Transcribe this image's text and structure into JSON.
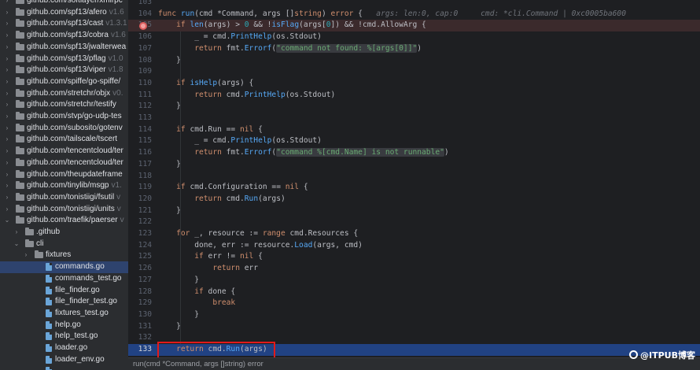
{
  "sidebar": {
    "rows": [
      {
        "type": "folder",
        "level": 1,
        "name": "github.com/softlayer/xmlrpc",
        "version": ""
      },
      {
        "type": "folder",
        "level": 1,
        "name": "github.com/spf13/afero",
        "version": "v1.6"
      },
      {
        "type": "folder",
        "level": 1,
        "name": "github.com/spf13/cast",
        "version": "v1.3.1"
      },
      {
        "type": "folder",
        "level": 1,
        "name": "github.com/spf13/cobra",
        "version": "v1.6"
      },
      {
        "type": "folder",
        "level": 1,
        "name": "github.com/spf13/jwalterwea",
        "version": ""
      },
      {
        "type": "folder",
        "level": 1,
        "name": "github.com/spf13/pflag",
        "version": "v1.0"
      },
      {
        "type": "folder",
        "level": 1,
        "name": "github.com/spf13/viper",
        "version": "v1.8"
      },
      {
        "type": "folder",
        "level": 1,
        "name": "github.com/spiffe/go-spiffe/",
        "version": ""
      },
      {
        "type": "folder",
        "level": 1,
        "name": "github.com/stretchr/objx",
        "version": "v0."
      },
      {
        "type": "folder",
        "level": 1,
        "name": "github.com/stretchr/testify",
        "version": ""
      },
      {
        "type": "folder",
        "level": 1,
        "name": "github.com/stvp/go-udp-tes",
        "version": ""
      },
      {
        "type": "folder",
        "level": 1,
        "name": "github.com/subosito/gotenv",
        "version": ""
      },
      {
        "type": "folder",
        "level": 1,
        "name": "github.com/tailscale/tscert",
        "version": ""
      },
      {
        "type": "folder",
        "level": 1,
        "name": "github.com/tencentcloud/ter",
        "version": ""
      },
      {
        "type": "folder",
        "level": 1,
        "name": "github.com/tencentcloud/ter",
        "version": ""
      },
      {
        "type": "folder",
        "level": 1,
        "name": "github.com/theupdateframe",
        "version": ""
      },
      {
        "type": "folder",
        "level": 1,
        "name": "github.com/tinylib/msgp",
        "version": "v1."
      },
      {
        "type": "folder",
        "level": 1,
        "name": "github.com/tonistiigi/fsutil",
        "version": "v"
      },
      {
        "type": "folder",
        "level": 1,
        "name": "github.com/tonistiigi/units",
        "version": "v"
      },
      {
        "type": "folder",
        "level": 1,
        "name": "github.com/traefik/paerser",
        "version": "v"
      },
      {
        "type": "folder",
        "level": 2,
        "name": ".github",
        "version": ""
      },
      {
        "type": "folder",
        "level": 2,
        "name": "cli",
        "version": ""
      },
      {
        "type": "folder",
        "level": 3,
        "name": "fixtures",
        "version": ""
      },
      {
        "type": "file",
        "level": 3,
        "name": "commands.go",
        "version": ""
      },
      {
        "type": "file",
        "level": 3,
        "name": "commands_test.go",
        "version": ""
      },
      {
        "type": "file",
        "level": 3,
        "name": "file_finder.go",
        "version": ""
      },
      {
        "type": "file",
        "level": 3,
        "name": "file_finder_test.go",
        "version": ""
      },
      {
        "type": "file",
        "level": 3,
        "name": "fixtures_test.go",
        "version": ""
      },
      {
        "type": "file",
        "level": 3,
        "name": "help.go",
        "version": ""
      },
      {
        "type": "file",
        "level": 3,
        "name": "help_test.go",
        "version": ""
      },
      {
        "type": "file",
        "level": 3,
        "name": "loader.go",
        "version": ""
      },
      {
        "type": "file",
        "level": 3,
        "name": "loader_env.go",
        "version": ""
      },
      {
        "type": "file",
        "level": 3,
        "name": "",
        "version": ""
      }
    ],
    "selected_name": "commands.go"
  },
  "editor": {
    "lines": [
      {
        "num": "103",
        "html": ""
      },
      {
        "num": "104",
        "html": "<span class='kw'>func</span> <span class='fn'>run</span>(cmd *Command, args []<span class='kw'>string</span>) <span class='kw'>error</span> {   <span class='hint'>args: len:0, cap:0     cmd: *cli.Command | 0xc0005ba600</span>"
      },
      {
        "num": "105",
        "html": "    <span class='kw'>if</span> <span class='fn'>len</span>(args) &gt; <span class='num'>0</span> &amp;&amp; !<span class='fn'>isFlag</span>(args[<span class='num'>0</span>]) &amp;&amp; !cmd.AllowArg {"
      },
      {
        "num": "106",
        "html": "        _ = cmd.<span class='fn'>PrintHelp</span>(os.Stdout)"
      },
      {
        "num": "107",
        "html": "        <span class='kw'>return</span> fmt.<span class='fn'>Errorf</span>(<span class='str hlbg'>\"command not found: %[args[0]]\"</span>)"
      },
      {
        "num": "108",
        "html": "    }"
      },
      {
        "num": "109",
        "html": ""
      },
      {
        "num": "110",
        "html": "    <span class='kw'>if</span> <span class='fn'>isHelp</span>(args) {"
      },
      {
        "num": "111",
        "html": "        <span class='kw'>return</span> cmd.<span class='fn'>PrintHelp</span>(os.Stdout)"
      },
      {
        "num": "112",
        "html": "    }"
      },
      {
        "num": "113",
        "html": ""
      },
      {
        "num": "114",
        "html": "    <span class='kw'>if</span> cmd.Run == <span class='kw'>nil</span> {"
      },
      {
        "num": "115",
        "html": "        _ = cmd.<span class='fn'>PrintHelp</span>(os.Stdout)"
      },
      {
        "num": "116",
        "html": "        <span class='kw'>return</span> fmt.<span class='fn'>Errorf</span>(<span class='str hlbg'>\"command %[cmd.Name] is not runnable\"</span>)"
      },
      {
        "num": "117",
        "html": "    }"
      },
      {
        "num": "118",
        "html": ""
      },
      {
        "num": "119",
        "html": "    <span class='kw'>if</span> cmd.Configuration == <span class='kw'>nil</span> {"
      },
      {
        "num": "120",
        "html": "        <span class='kw'>return</span> cmd.<span class='fn'>Run</span>(args)"
      },
      {
        "num": "121",
        "html": "    }"
      },
      {
        "num": "122",
        "html": ""
      },
      {
        "num": "123",
        "html": "    <span class='kw'>for</span> _, resource := <span class='kw'>range</span> cmd.Resources {"
      },
      {
        "num": "124",
        "html": "        done, err := resource.<span class='fn'>Load</span>(args, cmd)"
      },
      {
        "num": "125",
        "html": "        <span class='kw'>if</span> err != <span class='kw'>nil</span> {"
      },
      {
        "num": "126",
        "html": "            <span class='kw'>return</span> err"
      },
      {
        "num": "127",
        "html": "        }"
      },
      {
        "num": "128",
        "html": "        <span class='kw'>if</span> done {"
      },
      {
        "num": "129",
        "html": "            <span class='kw'>break</span>"
      },
      {
        "num": "130",
        "html": "        }"
      },
      {
        "num": "131",
        "html": "    }"
      },
      {
        "num": "132",
        "html": ""
      },
      {
        "num": "133",
        "html": "    <span class='kw'>return</span> cmd.<span class='fn'>Run</span>(args)"
      }
    ],
    "breakpoint_line": "105",
    "caret_line": "133"
  },
  "statusbar": {
    "signature": "run(cmd *Command, args []string) error"
  },
  "watermark": {
    "text": "@ITPUB博客"
  },
  "colors": {
    "accent": "#2e436e",
    "breakpoint": "#db5c5c",
    "highlight_box": "#e21a1a"
  }
}
